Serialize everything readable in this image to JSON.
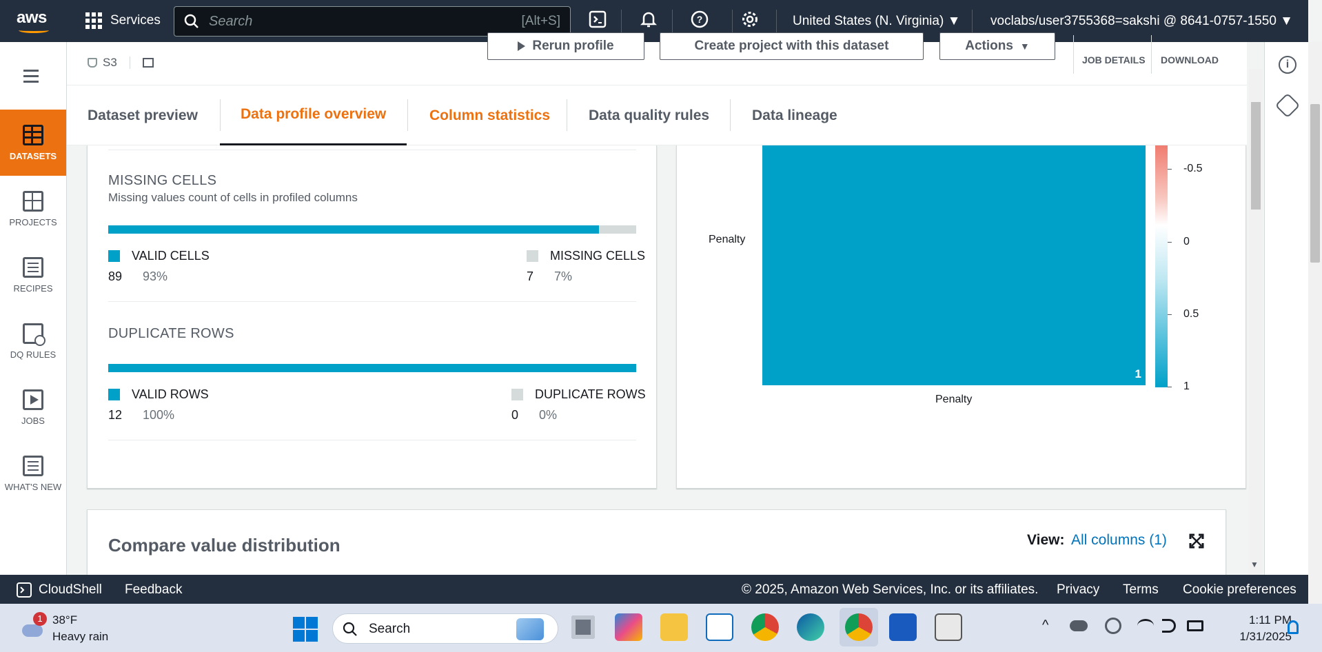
{
  "topnav": {
    "logo": "aws",
    "services_label": "Services",
    "search_placeholder": "Search",
    "search_shortcut": "[Alt+S]",
    "region": "United States (N. Virginia)",
    "account": "voclabs/user3755368=sakshi @ 8641-0757-1550"
  },
  "leftrail": {
    "items": [
      {
        "label": "DATASETS",
        "icon": "table-icon",
        "active": true
      },
      {
        "label": "PROJECTS",
        "icon": "grid-icon"
      },
      {
        "label": "RECIPES",
        "icon": "list-icon"
      },
      {
        "label": "DQ RULES",
        "icon": "clipboard-check-icon"
      },
      {
        "label": "JOBS",
        "icon": "play-icon"
      },
      {
        "label": "WHAT'S NEW",
        "icon": "newspaper-icon"
      }
    ]
  },
  "header": {
    "source_label": "S3",
    "rerun_label": "Rerun profile",
    "create_project_label": "Create project with this dataset",
    "actions_label": "Actions",
    "job_details_label": "JOB DETAILS",
    "download_label": "DOWNLOAD"
  },
  "tabs": [
    {
      "label": "Dataset preview"
    },
    {
      "label": "Data profile overview",
      "active": true
    },
    {
      "label": "Column statistics"
    },
    {
      "label": "Data quality rules"
    },
    {
      "label": "Data lineage"
    }
  ],
  "missing_cells": {
    "title": "MISSING CELLS",
    "description": "Missing values count of cells in profiled columns",
    "valid_fraction": 0.93,
    "valid_label": "VALID CELLS",
    "valid_count": "89",
    "valid_pct": "93%",
    "missing_label": "MISSING CELLS",
    "missing_count": "7",
    "missing_pct": "7%"
  },
  "duplicate_rows": {
    "title": "DUPLICATE ROWS",
    "valid_fraction": 1.0,
    "valid_label": "VALID ROWS",
    "valid_count": "12",
    "valid_pct": "100%",
    "dup_label": "DUPLICATE ROWS",
    "dup_count": "0",
    "dup_pct": "0%"
  },
  "correlation": {
    "row_label": "Penalty",
    "col_label": "Penalty",
    "cell_value": "1",
    "scale_ticks": [
      "-0.5",
      "0",
      "0.5",
      "1"
    ],
    "colors": {
      "cell": "#00a1c9",
      "negative": "#f07c70",
      "neutral": "#ffffff"
    }
  },
  "compare": {
    "title": "Compare value distribution",
    "view_label": "View:",
    "view_value": "All columns (1)"
  },
  "footer": {
    "cloudshell_label": "CloudShell",
    "feedback_label": "Feedback",
    "copyright": "© 2025, Amazon Web Services, Inc. or its affiliates.",
    "privacy": "Privacy",
    "terms": "Terms",
    "cookies": "Cookie preferences"
  },
  "taskbar": {
    "weather_temp": "38°F",
    "weather_desc": "Heavy rain",
    "weather_badge": "1",
    "search_label": "Search",
    "time": "1:11 PM",
    "date": "1/31/2025"
  },
  "colors": {
    "aws_orange": "#ec7211",
    "teal": "#00a1c9",
    "nav": "#232f3e"
  }
}
